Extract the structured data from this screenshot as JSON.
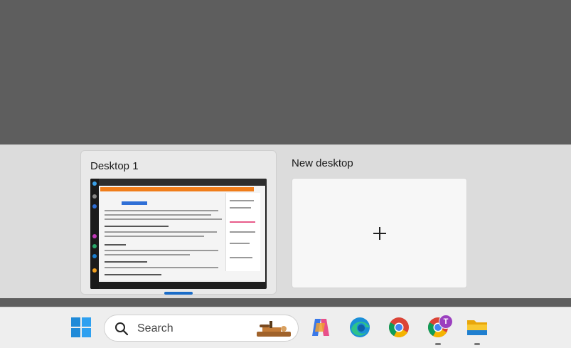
{
  "switcher": {
    "desktops": [
      {
        "title": "Desktop 1",
        "active": true
      },
      {
        "title": "New desktop",
        "active": false
      }
    ],
    "new_desktop_plus": "+"
  },
  "taskbar": {
    "search_label": "Search",
    "badge_letter": "T",
    "apps": [
      "start-icon",
      "copilot-icon",
      "edge-icon",
      "chrome-icon",
      "chrome-profile-icon",
      "file-explorer-icon"
    ]
  },
  "colors": {
    "accent": "#1a6cc7",
    "switcher_bg": "#dcdcdc",
    "taskbar_bg": "#eeeeee"
  }
}
